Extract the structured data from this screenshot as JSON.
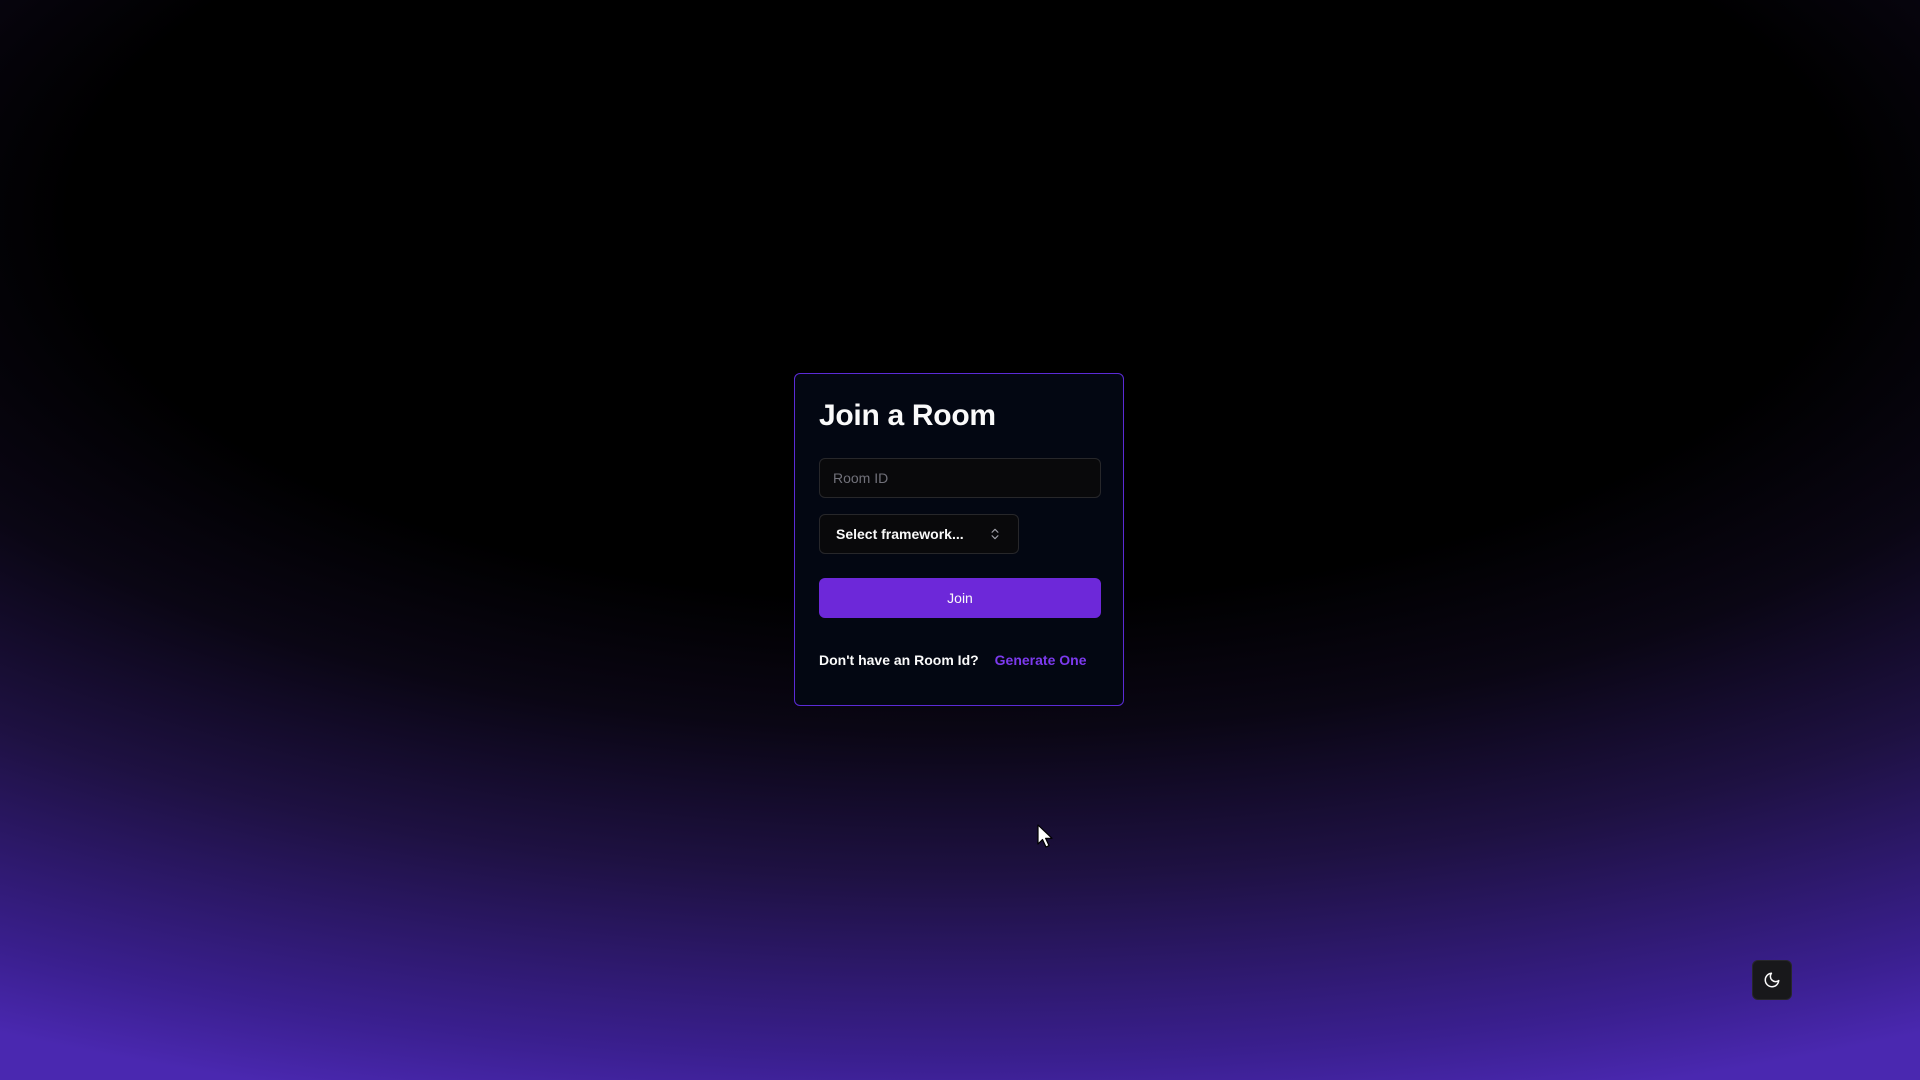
{
  "card": {
    "title": "Join a Room",
    "room_id_placeholder": "Room ID",
    "room_id_value": "",
    "framework_select": {
      "label": "Select framework...",
      "icon": "chevrons-up-down-icon"
    },
    "join_label": "Join",
    "footer": {
      "prompt": "Don't have an Room Id?",
      "link": "Generate One"
    }
  },
  "theme_toggle": {
    "icon": "moon-icon"
  },
  "colors": {
    "accent": "#6d28d9",
    "link": "#7c3aed",
    "card_border": "#5b2bd6",
    "card_bg": "#030712"
  }
}
